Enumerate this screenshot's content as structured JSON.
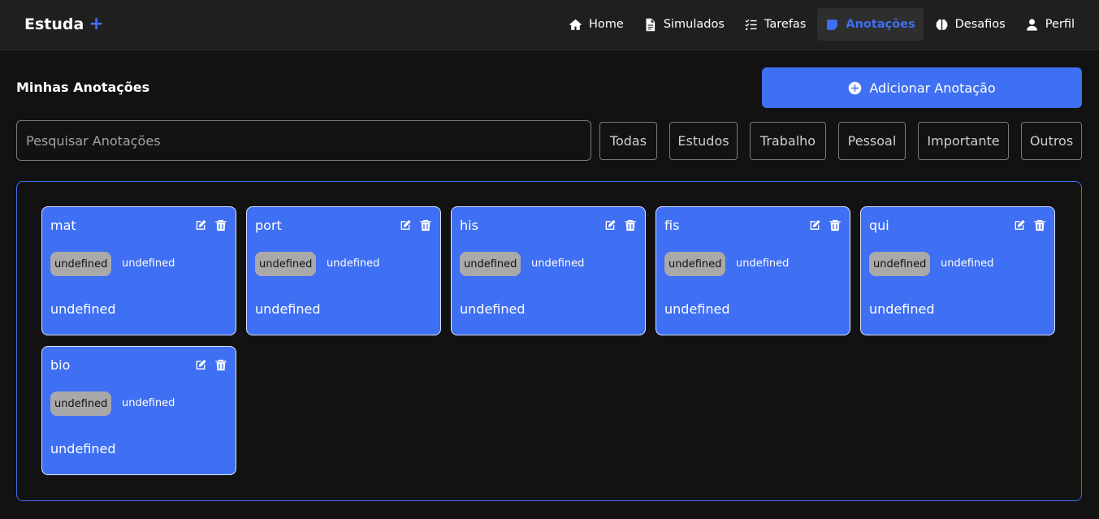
{
  "app": {
    "brand": "Estuda",
    "brand_plus": "+"
  },
  "nav": [
    {
      "label": "Home",
      "icon": "home-icon",
      "active": false
    },
    {
      "label": "Simulados",
      "icon": "file-icon",
      "active": false
    },
    {
      "label": "Tarefas",
      "icon": "tasks-icon",
      "active": false
    },
    {
      "label": "Anotações",
      "icon": "note-icon",
      "active": true
    },
    {
      "label": "Desafios",
      "icon": "brain-icon",
      "active": false
    },
    {
      "label": "Perfil",
      "icon": "user-icon",
      "active": false
    }
  ],
  "page": {
    "title": "Minhas Anotações",
    "add_button": "Adicionar Anotação"
  },
  "search": {
    "placeholder": "Pesquisar Anotações",
    "value": ""
  },
  "filters": [
    "Todas",
    "Estudos",
    "Trabalho",
    "Pessoal",
    "Importante",
    "Outros"
  ],
  "notes": [
    {
      "title": "mat",
      "category": "undefined",
      "date": "undefined",
      "content": "undefined"
    },
    {
      "title": "port",
      "category": "undefined",
      "date": "undefined",
      "content": "undefined"
    },
    {
      "title": "his",
      "category": "undefined",
      "date": "undefined",
      "content": "undefined"
    },
    {
      "title": "fis",
      "category": "undefined",
      "date": "undefined",
      "content": "undefined"
    },
    {
      "title": "qui",
      "category": "undefined",
      "date": "undefined",
      "content": "undefined"
    },
    {
      "title": "bio",
      "category": "undefined",
      "date": "undefined",
      "content": "undefined"
    }
  ],
  "colors": {
    "accent": "#3f6ff2",
    "background": "#121212",
    "navbar": "#1f1f1f",
    "tag": "#a9a9a9"
  }
}
